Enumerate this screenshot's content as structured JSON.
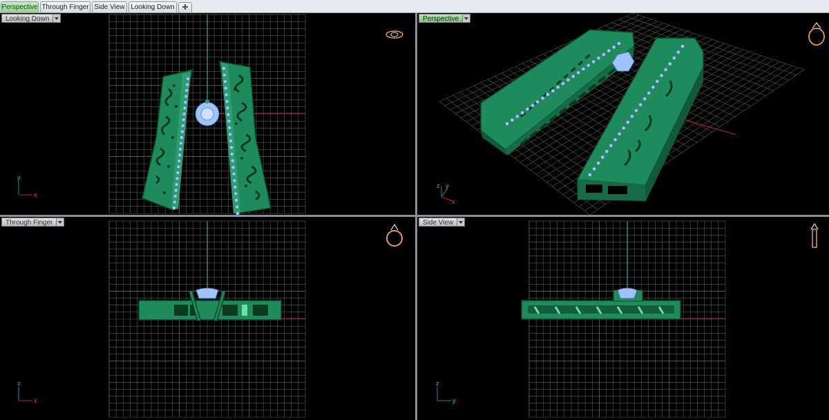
{
  "tabs": [
    {
      "label": "Perspective",
      "active": true
    },
    {
      "label": "Through Finger",
      "active": false
    },
    {
      "label": "Side View",
      "active": false
    },
    {
      "label": "Looking Down",
      "active": false
    }
  ],
  "add_tab_icon": "plus-icon",
  "viewports": {
    "looking_down": {
      "label": "Looking Down",
      "axis_v": "y",
      "axis_h": "x"
    },
    "perspective": {
      "label": "Perspective",
      "axis_v": "z",
      "axis_d": "y",
      "axis_h": "x"
    },
    "through_finger": {
      "label": "Through Finger",
      "axis_v": "z",
      "axis_h": "x"
    },
    "side_view": {
      "label": "Side View",
      "axis_v": "z",
      "axis_h": "y"
    }
  },
  "colors": {
    "grid": "#5a5a5a",
    "model_green": "#1f8a5a",
    "model_dark": "#0c4a2c",
    "gem_blue": "#9ec4ff",
    "axis_red": "#c02020",
    "axis_green": "#1a9a3a",
    "axis_blue": "#2a7fd0",
    "active_tab": "#8fd38b"
  },
  "icons": [
    "ring-top-icon",
    "ring-perspective-icon",
    "ring-front-icon",
    "ring-side-icon",
    "viewport-dropdown-icon"
  ]
}
